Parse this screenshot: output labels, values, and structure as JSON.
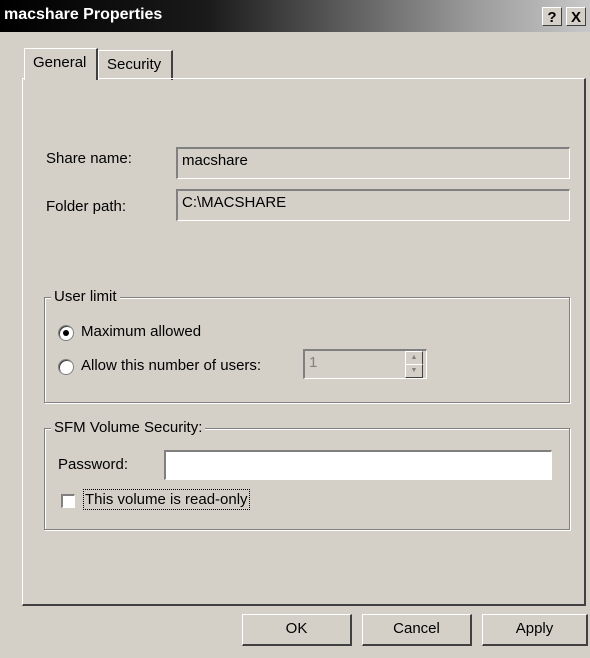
{
  "window": {
    "title": "macshare Properties",
    "help_glyph": "?",
    "close_glyph": "X"
  },
  "tabs": [
    {
      "label": "General",
      "selected": true
    },
    {
      "label": "Security",
      "selected": false
    }
  ],
  "general": {
    "share_name_label": "Share name:",
    "share_name_value": "macshare",
    "folder_path_label": "Folder path:",
    "folder_path_value": "C:\\MACSHARE"
  },
  "user_limit": {
    "legend": "User limit",
    "max_allowed_label": "Maximum allowed",
    "allow_users_label": "Allow this number of users:",
    "users_count": "1",
    "selected_option": "Maximum allowed"
  },
  "sfm": {
    "legend": "SFM Volume Security:",
    "password_label": "Password:",
    "password_value": "",
    "readonly_label": "This volume is read-only",
    "readonly_checked": false
  },
  "buttons": {
    "ok": "OK",
    "cancel": "Cancel",
    "apply": "Apply"
  },
  "icons": {
    "spin_up": "spin-up-arrow-icon",
    "spin_down": "spin-down-arrow-icon"
  }
}
